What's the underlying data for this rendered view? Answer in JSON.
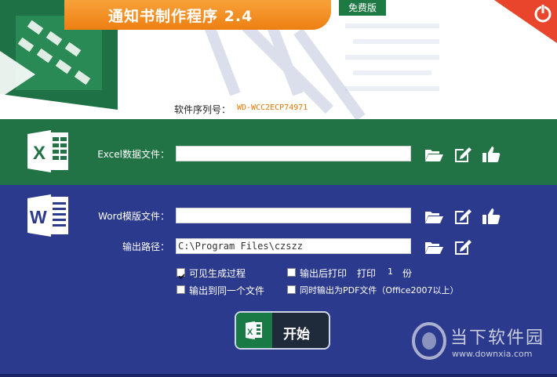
{
  "window": {
    "title": "通知书制作程序 2.4",
    "edition_badge": "免费版",
    "serial_label": "软件序列号：",
    "serial_value": "WD-WCC2ECP74971"
  },
  "excel": {
    "label": "Excel数据文件：",
    "value": ""
  },
  "word_template": {
    "label": "Word模版文件：",
    "value": ""
  },
  "output_path": {
    "label": "输出路径：",
    "value": "C:\\Program Files\\czszz"
  },
  "options": {
    "visible_process": {
      "label": "可见生成过程",
      "checked": true
    },
    "print_after_output": {
      "label": "输出后打印",
      "checked": false
    },
    "print_prefix": "打印",
    "print_copies": "1",
    "print_suffix": "份",
    "output_same_file": {
      "label": "输出到同一个文件",
      "checked": false
    },
    "output_pdf": {
      "label": "同时输出为PDF文件（Office2007以上）",
      "checked": false
    }
  },
  "start_button": {
    "label": "开始"
  },
  "watermark": {
    "title": "当下软件园",
    "url": "www.downxia.com"
  },
  "colors": {
    "excel_green": "#217346",
    "word_blue": "#2b3a8c",
    "title_orange": "#ee7f12",
    "power_red": "#e8452c"
  },
  "icons": [
    "folder-open-icon",
    "edit-icon",
    "thumbs-up-icon",
    "power-icon",
    "excel-logo-icon",
    "word-logo-icon"
  ]
}
